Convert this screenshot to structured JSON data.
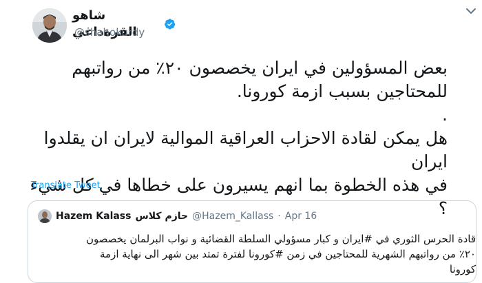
{
  "tweet": {
    "display_name": "شاهو القرةداغي",
    "handle": "@shahokurdy",
    "text_lines": [
      "بعض المسؤولين في ايران يخصصون ٢٠٪ من رواتبهم",
      "للمحتاجين بسبب ازمة كورونا.",
      ".",
      "هل يمكن لقادة الاحزاب العراقية الموالية لايران ان يقلدوا ايران",
      "في هذه الخطوة بما انهم يسيرون على خطاها في كل شيء ؟"
    ],
    "translate_label": "Translate Tweet"
  },
  "quoted": {
    "name_en": "Hazem Kalass",
    "name_ar": "حازم كلاس",
    "handle": "@Hazem_Kallass",
    "separator": "·",
    "date": "Apr 16",
    "text_lines": [
      "قادة الحرس الثوري في #ايران و كبار مسؤولي السلطة القضائية و نواب البرلمان يخصصون",
      "٢٠٪ من رواتبهم الشهرية للمحتاجين في زمن #كورونا لفترة تمتد بين شهر الى نهاية ازمة",
      "كورونا"
    ]
  },
  "icons": {
    "verified": "verified-badge-icon",
    "more": "chevron-down-icon"
  },
  "colors": {
    "link": "#1da1f2",
    "verified": "#1da1f2",
    "secondary_text": "#657786",
    "border": "#ccd6dd"
  }
}
